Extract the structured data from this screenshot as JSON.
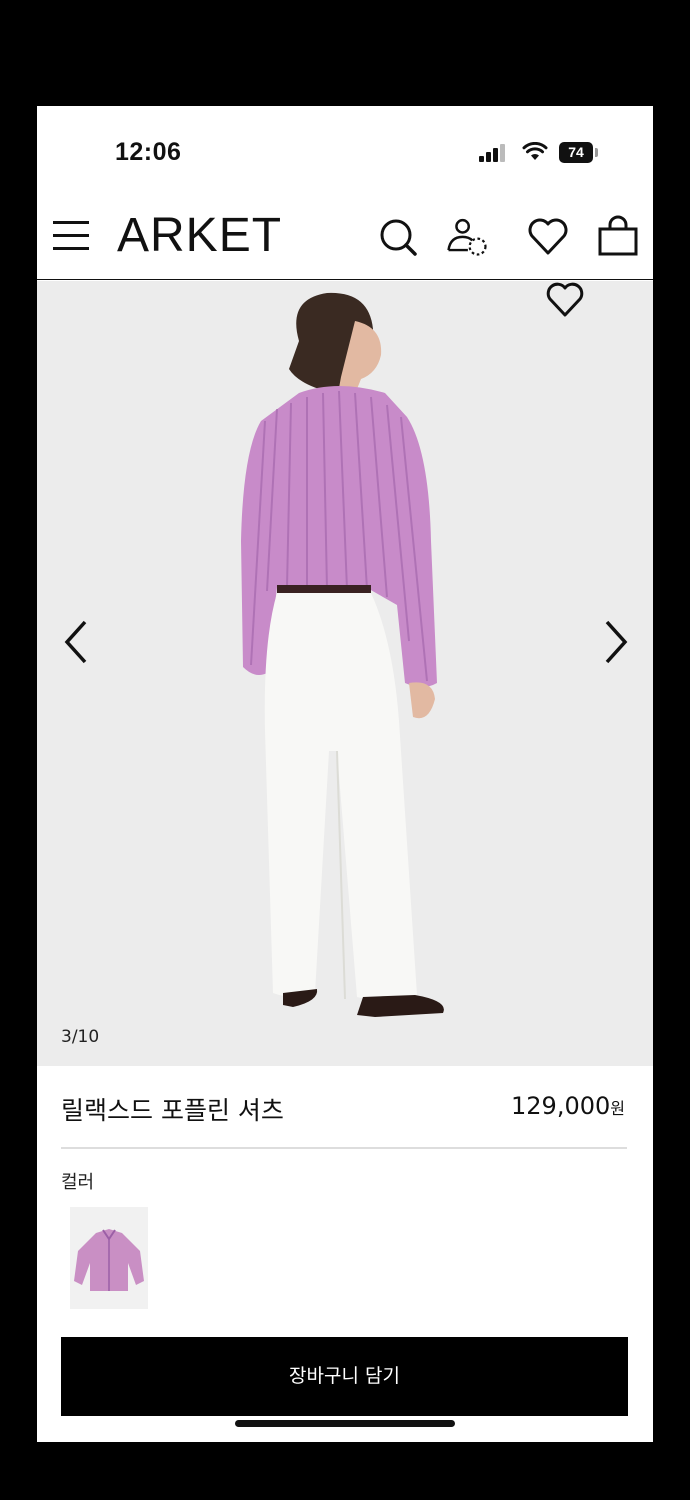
{
  "status_bar": {
    "time": "12:06",
    "battery": "74"
  },
  "header": {
    "brand": "ARKET",
    "icons": [
      "menu-icon",
      "search-icon",
      "account-icon",
      "wishlist-icon",
      "bag-icon"
    ]
  },
  "gallery": {
    "counter": "3/10",
    "icons": [
      "heart-icon",
      "chevron-left-icon",
      "chevron-right-icon"
    ]
  },
  "product": {
    "name": "릴랙스드 포플린 셔츠",
    "price_amount": "129,000",
    "price_unit": "원",
    "color_label": "컬러",
    "swatch_color": "#c98fc4"
  },
  "actions": {
    "add_to_cart": "장바구니 담기"
  }
}
